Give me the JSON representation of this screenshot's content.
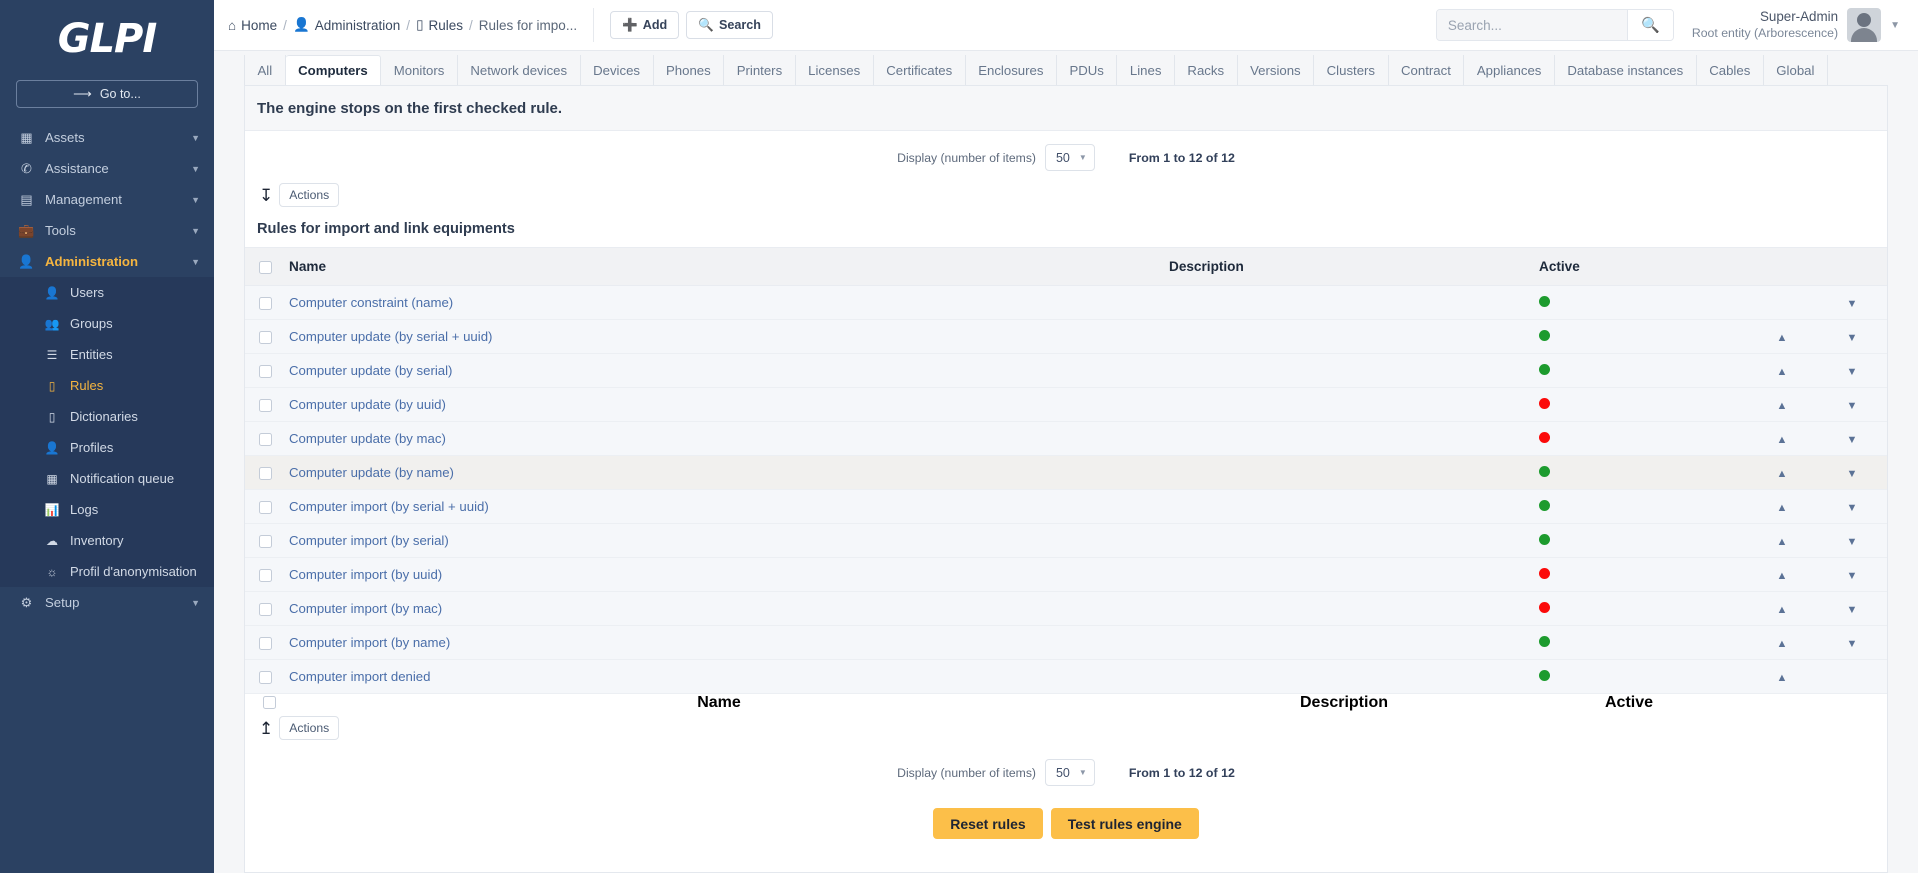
{
  "brand": {
    "logo_text": "GLPI",
    "goto_label": "Go to...",
    "goto_icon": "arrow-right-icon"
  },
  "sidebar": {
    "items": [
      {
        "label": "Assets",
        "icon": "assets-icon",
        "chevron": "⌄"
      },
      {
        "label": "Assistance",
        "icon": "assistance-icon",
        "chevron": "⌄"
      },
      {
        "label": "Management",
        "icon": "management-icon",
        "chevron": "⌄"
      },
      {
        "label": "Tools",
        "icon": "tools-icon",
        "chevron": "⌄"
      },
      {
        "label": "Administration",
        "icon": "administration-icon",
        "chevron": "⌄"
      },
      {
        "label": "Setup",
        "icon": "setup-icon",
        "chevron": "⌄"
      }
    ],
    "subitems": [
      {
        "label": "Users",
        "icon": "user-icon"
      },
      {
        "label": "Groups",
        "icon": "groups-icon"
      },
      {
        "label": "Entities",
        "icon": "entities-icon"
      },
      {
        "label": "Rules",
        "icon": "rules-icon"
      },
      {
        "label": "Dictionaries",
        "icon": "dictionary-icon"
      },
      {
        "label": "Profiles",
        "icon": "profile-icon"
      },
      {
        "label": "Notification queue",
        "icon": "notification-icon"
      },
      {
        "label": "Logs",
        "icon": "logs-icon"
      },
      {
        "label": "Inventory",
        "icon": "inventory-cloud-icon"
      },
      {
        "label": "Profil d'anonymisation",
        "icon": "mask-icon"
      }
    ]
  },
  "topbar": {
    "breadcrumb": [
      {
        "label": "Home",
        "icon": "home-icon"
      },
      {
        "label": "Administration",
        "icon": "administration-icon"
      },
      {
        "label": "Rules",
        "icon": "rules-icon"
      },
      {
        "label": "Rules for impo...",
        "icon": ""
      }
    ],
    "add_label": "Add",
    "add_icon": "plus-icon",
    "search_label": "Search",
    "search_icon": "magnifier-icon",
    "search_placeholder": "Search...",
    "search_value": "",
    "user_name": "Super-Admin",
    "user_entity": "Root entity (Arborescence)",
    "avatar_icon": "avatar-icon",
    "caret_icon": "chevron-down-icon"
  },
  "tabs": [
    {
      "label": "All",
      "active": false
    },
    {
      "label": "Computers",
      "active": true
    },
    {
      "label": "Monitors",
      "active": false
    },
    {
      "label": "Network devices",
      "active": false
    },
    {
      "label": "Devices",
      "active": false
    },
    {
      "label": "Phones",
      "active": false
    },
    {
      "label": "Printers",
      "active": false
    },
    {
      "label": "Licenses",
      "active": false
    },
    {
      "label": "Certificates",
      "active": false
    },
    {
      "label": "Enclosures",
      "active": false
    },
    {
      "label": "PDUs",
      "active": false
    },
    {
      "label": "Lines",
      "active": false
    },
    {
      "label": "Racks",
      "active": false
    },
    {
      "label": "Versions",
      "active": false
    },
    {
      "label": "Clusters",
      "active": false
    },
    {
      "label": "Contract",
      "active": false
    },
    {
      "label": "Appliances",
      "active": false
    },
    {
      "label": "Database instances",
      "active": false
    },
    {
      "label": "Cables",
      "active": false
    },
    {
      "label": "Global",
      "active": false
    }
  ],
  "content": {
    "engine_note": "The engine stops on the first checked rule.",
    "display_label": "Display (number of items)",
    "display_value": "50",
    "range_text": "From 1 to 12 of 12",
    "actions_label": "Actions",
    "actions_icon_top": "arrow-down-icon",
    "actions_icon_bottom": "arrow-up-icon",
    "table_title": "Rules for import and link equipments",
    "columns": {
      "name": "Name",
      "description": "Description",
      "active": "Active"
    },
    "colors": {
      "active_on": "#1d9b2e",
      "active_off": "#fb0a0a",
      "accent": "#fcbf49",
      "link": "#4a6ea9"
    },
    "rows": [
      {
        "name": "Computer constraint (name)",
        "description": "",
        "active": true,
        "can_up": false,
        "can_down": true
      },
      {
        "name": "Computer update (by serial + uuid)",
        "description": "",
        "active": true,
        "can_up": true,
        "can_down": true
      },
      {
        "name": "Computer update (by serial)",
        "description": "",
        "active": true,
        "can_up": true,
        "can_down": true
      },
      {
        "name": "Computer update (by uuid)",
        "description": "",
        "active": false,
        "can_up": true,
        "can_down": true
      },
      {
        "name": "Computer update (by mac)",
        "description": "",
        "active": false,
        "can_up": true,
        "can_down": true
      },
      {
        "name": "Computer update (by name)",
        "description": "",
        "active": true,
        "can_up": true,
        "can_down": true
      },
      {
        "name": "Computer import (by serial + uuid)",
        "description": "",
        "active": true,
        "can_up": true,
        "can_down": true
      },
      {
        "name": "Computer import (by serial)",
        "description": "",
        "active": true,
        "can_up": true,
        "can_down": true
      },
      {
        "name": "Computer import (by uuid)",
        "description": "",
        "active": false,
        "can_up": true,
        "can_down": true
      },
      {
        "name": "Computer import (by mac)",
        "description": "",
        "active": false,
        "can_up": true,
        "can_down": true
      },
      {
        "name": "Computer import (by name)",
        "description": "",
        "active": true,
        "can_up": true,
        "can_down": true
      },
      {
        "name": "Computer import denied",
        "description": "",
        "active": true,
        "can_up": true,
        "can_down": false
      }
    ],
    "reset_label": "Reset rules",
    "test_label": "Test rules engine"
  }
}
